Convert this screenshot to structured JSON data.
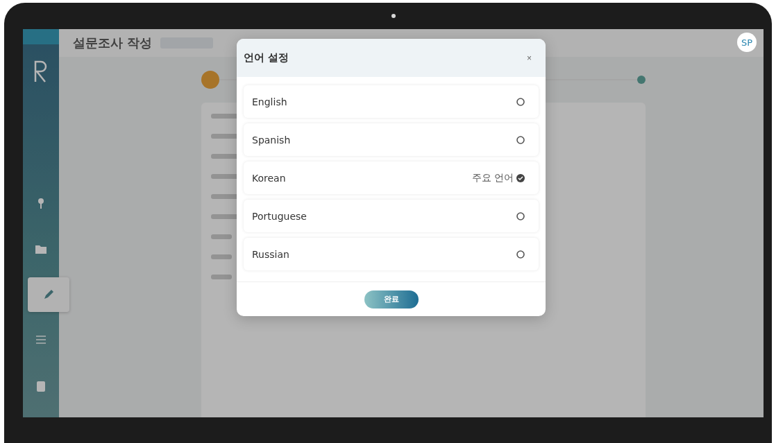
{
  "header": {
    "title": "설문조사 작성"
  },
  "avatar": "SP",
  "nav": [
    {
      "kind": "pin",
      "selected": false
    },
    {
      "kind": "folder",
      "selected": false
    },
    {
      "kind": "pencil",
      "selected": true
    },
    {
      "kind": "list",
      "selected": false
    },
    {
      "kind": "document",
      "selected": false
    }
  ],
  "dialog": {
    "title": "언어 설정",
    "close": "×",
    "languages": [
      {
        "label": "English",
        "selected": false
      },
      {
        "label": "Spanish",
        "selected": false
      },
      {
        "label": "Korean",
        "selected": true,
        "note": "주요 언어"
      },
      {
        "label": "Portuguese",
        "selected": false
      },
      {
        "label": "Russian",
        "selected": false
      }
    ],
    "confirm": "완료"
  }
}
